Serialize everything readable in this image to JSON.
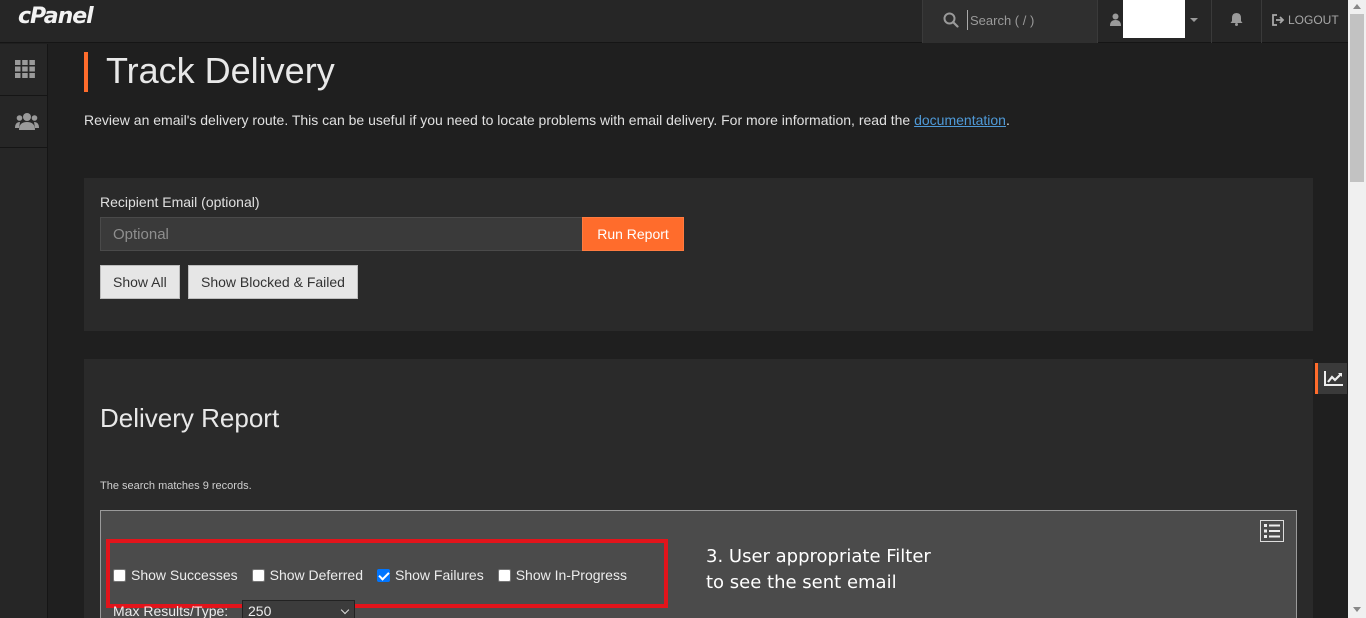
{
  "header": {
    "logo": "cPanel",
    "search_placeholder": "Search ( / )",
    "logout_label": "LOGOUT"
  },
  "icons": {
    "search": "search-icon",
    "user": "user-icon",
    "caret": "caret-down-icon",
    "bell": "bell-icon",
    "logout": "logout-icon",
    "grid": "grid-icon",
    "users": "users-icon",
    "list": "list-icon",
    "stats": "chart-line-icon"
  },
  "colors": {
    "accent": "#ff6c2c",
    "annotation_border": "#e2141b",
    "link": "#4f9ad8"
  },
  "page": {
    "title": "Track Delivery",
    "description_prefix": "Review an email's delivery route. This can be useful if you need to locate problems with email delivery. For more information, read the ",
    "documentation_link": "documentation",
    "description_suffix": "."
  },
  "form": {
    "recipient_label": "Recipient Email (optional)",
    "recipient_placeholder": "Optional",
    "run_report_label": "Run Report",
    "show_all_label": "Show All",
    "show_blocked_label": "Show Blocked & Failed"
  },
  "report": {
    "title": "Delivery Report",
    "matches_text": "The search matches 9 records.",
    "filters": [
      {
        "label": "Show Successes",
        "checked": false
      },
      {
        "label": "Show Deferred",
        "checked": false
      },
      {
        "label": "Show Failures",
        "checked": true
      },
      {
        "label": "Show In-Progress",
        "checked": false
      }
    ],
    "max_results_label": "Max Results/Type:",
    "max_results_value": "250"
  },
  "annotation": {
    "line1": "3. User appropriate Filter",
    "line2": "to see the sent email"
  }
}
